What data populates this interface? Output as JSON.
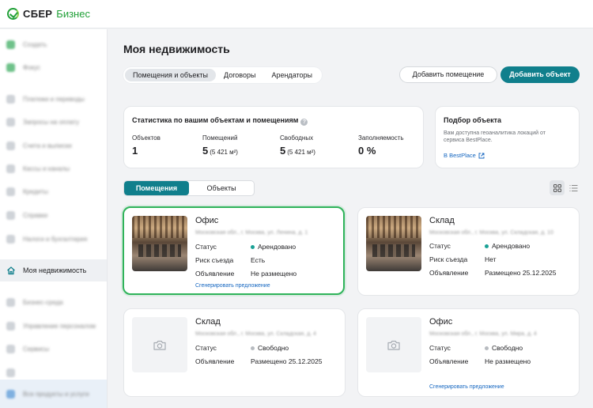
{
  "brand": {
    "name": "СБЕР",
    "product": "Бизнес"
  },
  "sidebar": {
    "active_label": "Моя недвижимость",
    "blurred_labels": [
      "Создать",
      "Фокус",
      "Платежи и переводы",
      "Запросы на оплату",
      "Счета и выписки",
      "Кассы и каналы",
      "Кредиты",
      "Справки",
      "Налоги и бухгалтерия",
      "Бизнес-среда",
      "Управление персоналом",
      "Сервисы",
      "Все продукты и услуги"
    ]
  },
  "page": {
    "title": "Моя недвижимость",
    "tabs": [
      "Помещения и объекты",
      "Договоры",
      "Арендаторы"
    ],
    "add_room_label": "Добавить помещение",
    "add_object_label": "Добавить объект"
  },
  "stats": {
    "title": "Статистика по вашим объектам и помещениям",
    "help_glyph": "?",
    "items": [
      {
        "label": "Объектов",
        "value": "1",
        "sub": ""
      },
      {
        "label": "Помещений",
        "value": "5",
        "sub": "(5 421 м²)"
      },
      {
        "label": "Свободных",
        "value": "5",
        "sub": "(5 421 м²)"
      },
      {
        "label": "Заполняемость",
        "value": "0 %",
        "sub": ""
      }
    ]
  },
  "podbor": {
    "title": "Подбор объекта",
    "desc": "Вам доступна геоаналитика локаций от сервиса BestPlace.",
    "link": "В BestPlace"
  },
  "segment": {
    "rooms": "Помещения",
    "objects": "Объекты"
  },
  "properties": [
    {
      "title": "Офис",
      "address": "Московская обл., г. Москва, ул. Ленина, д. 1",
      "rows": [
        {
          "key": "Статус",
          "value": "Арендовано",
          "dot": "green"
        },
        {
          "key": "Риск съезда",
          "value": "Есть"
        },
        {
          "key": "Объявление",
          "value": "Не размещено"
        }
      ],
      "link": "Сгенерировать предложение"
    },
    {
      "title": "Склад",
      "address": "Московская обл., г. Москва, ул. Складская, д. 10",
      "rows": [
        {
          "key": "Статус",
          "value": "Арендовано",
          "dot": "green"
        },
        {
          "key": "Риск съезда",
          "value": "Нет"
        },
        {
          "key": "Объявление",
          "value": "Размещено 25.12.2025"
        }
      ],
      "link": ""
    },
    {
      "title": "Склад",
      "address": "Московская обл., г. Москва, ул. Складская, д. 4",
      "rows": [
        {
          "key": "Статус",
          "value": "Свободно",
          "dot": "gray"
        },
        {
          "key": "Объявление",
          "value": "Размещено 25.12.2025"
        }
      ],
      "link": ""
    },
    {
      "title": "Офис",
      "address": "Московская обл., г. Москва, ул. Мира, д. 4",
      "rows": [
        {
          "key": "Статус",
          "value": "Свободно",
          "dot": "gray"
        },
        {
          "key": "Объявление",
          "value": "Не размещено"
        }
      ],
      "link": "Сгенерировать предложение"
    }
  ],
  "icons": {
    "logo": "sber-logo-icon",
    "house": "house-icon",
    "help": "help-icon",
    "external": "external-link-icon",
    "camera": "camera-icon",
    "grid": "grid-view-icon",
    "list": "list-view-icon"
  },
  "colors": {
    "accent": "#107f8c",
    "brand": "#21a038",
    "selected_border": "#2fb35a",
    "link": "#1466c0"
  }
}
